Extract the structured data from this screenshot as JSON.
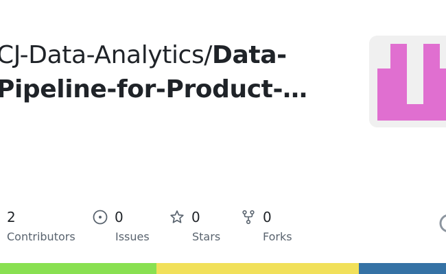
{
  "repo": {
    "owner": "CJ-Data-Analytics/",
    "name_line1": "Data-",
    "name_line2": "Pipeline-for-Product-…"
  },
  "stats": {
    "contributors": {
      "count": "2",
      "label": "Contributors",
      "icon": "people-icon"
    },
    "issues": {
      "count": "0",
      "label": "Issues",
      "icon": "issue-opened-icon"
    },
    "stars": {
      "count": "0",
      "label": "Stars",
      "icon": "star-icon"
    },
    "forks": {
      "count": "0",
      "label": "Forks",
      "icon": "repo-forked-icon"
    }
  },
  "language_bar": {
    "segments": [
      {
        "color": "#89e051",
        "fraction": 0.35
      },
      {
        "color": "#f1e05a",
        "fraction": 0.455
      },
      {
        "color": "#3572a5",
        "fraction": 0.195
      }
    ]
  },
  "colors": {
    "avatar_accent": "#e06fd0",
    "avatar_bg": "#f0f0f0",
    "muted_text": "#59636e"
  }
}
